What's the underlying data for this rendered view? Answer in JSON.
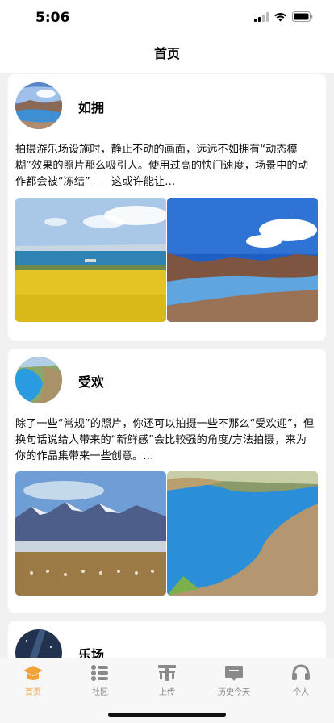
{
  "status_bar": {
    "time": "5:06"
  },
  "nav": {
    "title": "首页"
  },
  "posts": [
    {
      "title": "如拥",
      "text": "拍摄游乐场设施时，静止不动的画面，远远不如拥有“动态模糊”效果的照片那么吸引人。使用过高的快门速度，场景中的动作都会被“冻结”——这或许能让…"
    },
    {
      "title": "受欢",
      "text": "除了一些“常规”的照片，你还可以拍摄一些不那么“受欢迎”，但换句话说给人带来的“新鲜感”会比较强的角度/方法拍摄，来为你的作品集带来一些创意。…"
    },
    {
      "title": "乐场",
      "text": ""
    }
  ],
  "tabs": [
    {
      "label": "首页",
      "icon": "graduation-cap-icon",
      "active": true
    },
    {
      "label": "社区",
      "icon": "list-icon",
      "active": false
    },
    {
      "label": "上传",
      "icon": "upload-icon",
      "active": false
    },
    {
      "label": "历史今天",
      "icon": "chat-bubble-icon",
      "active": false
    },
    {
      "label": "个人",
      "icon": "headset-icon",
      "active": false
    }
  ],
  "colors": {
    "accent": "#f1a33a",
    "inactive": "#8a8a8a"
  }
}
